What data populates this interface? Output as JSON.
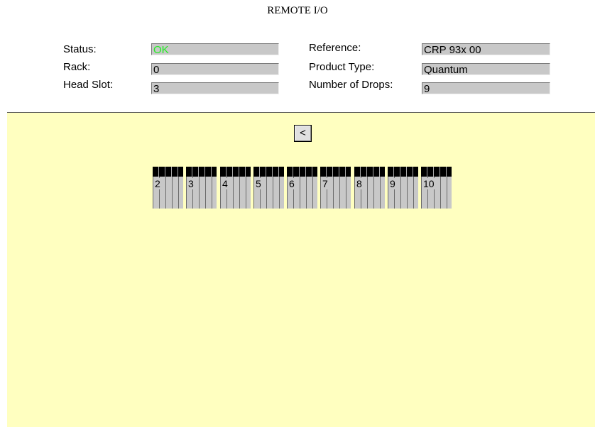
{
  "title": "REMOTE I/O",
  "fields_left": [
    {
      "label": "Status:",
      "value": "OK"
    },
    {
      "label": "Rack:",
      "value": "0"
    },
    {
      "label": "Head Slot:",
      "value": "3"
    }
  ],
  "fields_right": [
    {
      "label": "Reference:",
      "value": "CRP 93x 00"
    },
    {
      "label": "Product Type:",
      "value": "Quantum"
    },
    {
      "label": "Number of Drops:",
      "value": "9"
    }
  ],
  "nav": {
    "prev_label": "<"
  },
  "drops": [
    "2",
    "3",
    "4",
    "5",
    "6",
    "7",
    "8",
    "9",
    "10"
  ],
  "colors": {
    "panel_bg": "#ffffc0",
    "status_ok": "#22ee22",
    "field_bg": "#c8c8c8"
  }
}
